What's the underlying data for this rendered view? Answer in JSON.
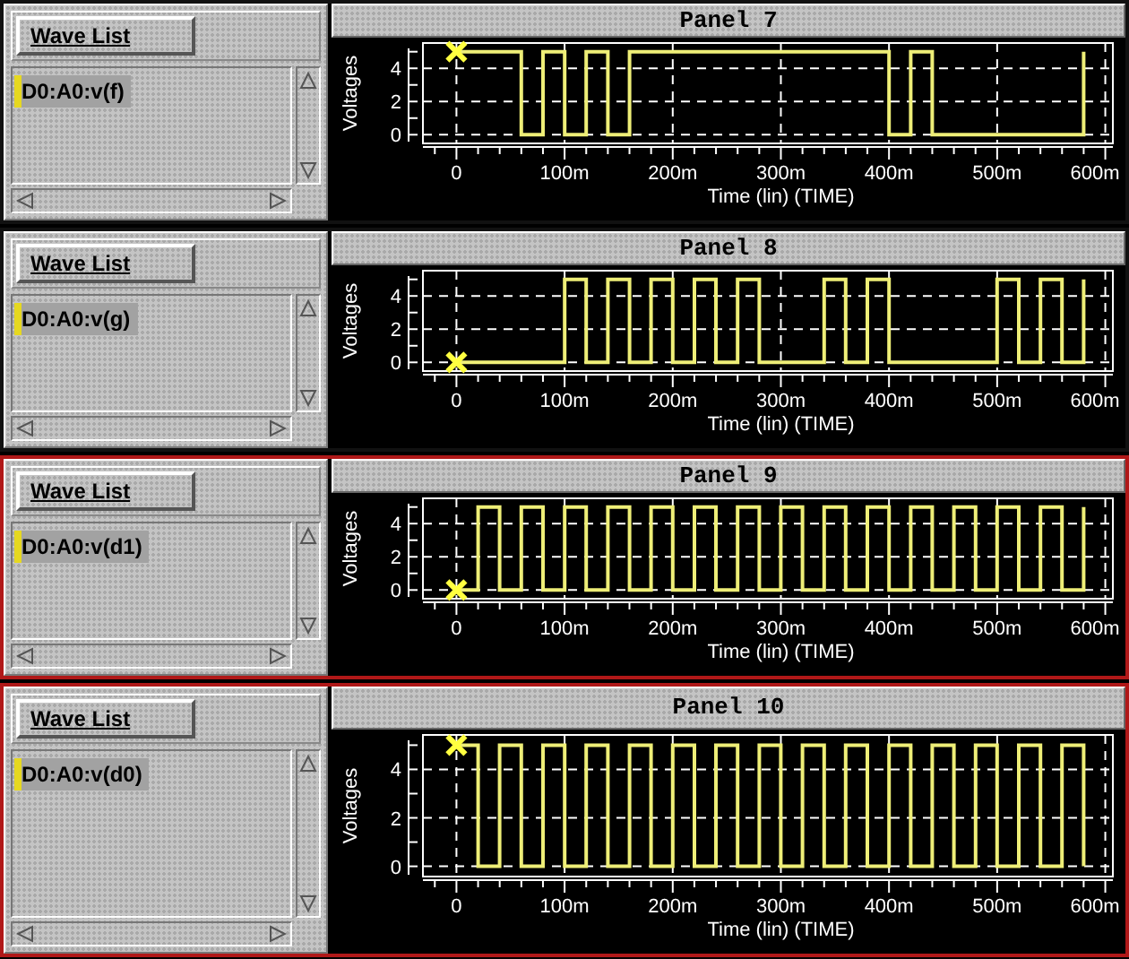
{
  "panels": [
    {
      "highlighted": false,
      "wave_list": {
        "button": "Wave List",
        "items": [
          {
            "label": "D0:A0:v(f)",
            "selected": true
          }
        ]
      },
      "title": "Panel 7",
      "chart_data": {
        "type": "line",
        "xlabel": "Time (lin) (TIME)",
        "ylabel": "Voltages",
        "xlim": [
          -31,
          607
        ],
        "ylim": [
          -0.2,
          5.2
        ],
        "yticks": [
          0,
          2,
          4
        ],
        "grid": true,
        "xticks": [
          {
            "value": 0,
            "label": "0"
          },
          {
            "value": 100,
            "label": "100m"
          },
          {
            "value": 200,
            "label": "200m"
          },
          {
            "value": 300,
            "label": "300m"
          },
          {
            "value": 400,
            "label": "400m"
          },
          {
            "value": 500,
            "label": "500m"
          },
          {
            "value": 600,
            "label": "600m"
          }
        ],
        "x": [
          0,
          60,
          60,
          80,
          80,
          100,
          100,
          120,
          120,
          140,
          140,
          160,
          160,
          400,
          400,
          420,
          420,
          440,
          440,
          580,
          580
        ],
        "series": [
          {
            "color": "#eeee77",
            "values": [
              5,
              5,
              0,
              0,
              5,
              5,
              0,
              0,
              5,
              5,
              0,
              0,
              5,
              5,
              0,
              0,
              5,
              5,
              0,
              0,
              5
            ]
          }
        ]
      }
    },
    {
      "highlighted": false,
      "wave_list": {
        "button": "Wave List",
        "items": [
          {
            "label": "D0:A0:v(g)",
            "selected": true
          }
        ]
      },
      "title": "Panel 8",
      "chart_data": {
        "type": "line",
        "xlabel": "Time (lin) (TIME)",
        "ylabel": "Voltages",
        "xlim": [
          -31,
          607
        ],
        "ylim": [
          -0.2,
          5.2
        ],
        "yticks": [
          0,
          2,
          4
        ],
        "grid": true,
        "xticks": [
          {
            "value": 0,
            "label": "0"
          },
          {
            "value": 100,
            "label": "100m"
          },
          {
            "value": 200,
            "label": "200m"
          },
          {
            "value": 300,
            "label": "300m"
          },
          {
            "value": 400,
            "label": "400m"
          },
          {
            "value": 500,
            "label": "500m"
          },
          {
            "value": 600,
            "label": "600m"
          }
        ],
        "x": [
          0,
          100,
          100,
          120,
          120,
          140,
          140,
          160,
          160,
          180,
          180,
          200,
          200,
          220,
          220,
          240,
          240,
          260,
          260,
          280,
          280,
          340,
          340,
          360,
          360,
          380,
          380,
          400,
          400,
          500,
          500,
          520,
          520,
          540,
          540,
          560,
          560,
          580,
          580
        ],
        "series": [
          {
            "color": "#eeee77",
            "values": [
              0,
              0,
              5,
              5,
              0,
              0,
              5,
              5,
              0,
              0,
              5,
              5,
              0,
              0,
              5,
              5,
              0,
              0,
              5,
              5,
              0,
              0,
              5,
              5,
              0,
              0,
              5,
              5,
              0,
              0,
              5,
              5,
              0,
              0,
              5,
              5,
              0,
              0,
              5
            ]
          }
        ]
      }
    },
    {
      "highlighted": true,
      "wave_list": {
        "button": "Wave List",
        "items": [
          {
            "label": "D0:A0:v(d1)",
            "selected": true
          }
        ]
      },
      "title": "Panel 9",
      "chart_data": {
        "type": "line",
        "xlabel": "Time (lin) (TIME)",
        "ylabel": "Voltages",
        "xlim": [
          -31,
          607
        ],
        "ylim": [
          -0.2,
          5.2
        ],
        "yticks": [
          0,
          2,
          4
        ],
        "grid": true,
        "xticks": [
          {
            "value": 0,
            "label": "0"
          },
          {
            "value": 100,
            "label": "100m"
          },
          {
            "value": 200,
            "label": "200m"
          },
          {
            "value": 300,
            "label": "300m"
          },
          {
            "value": 400,
            "label": "400m"
          },
          {
            "value": 500,
            "label": "500m"
          },
          {
            "value": 600,
            "label": "600m"
          }
        ],
        "x": [
          0,
          20,
          20,
          40,
          40,
          60,
          60,
          80,
          80,
          100,
          100,
          120,
          120,
          140,
          140,
          160,
          160,
          180,
          180,
          200,
          200,
          220,
          220,
          240,
          240,
          260,
          260,
          280,
          280,
          300,
          300,
          320,
          320,
          340,
          340,
          360,
          360,
          380,
          380,
          400,
          400,
          420,
          420,
          440,
          440,
          460,
          460,
          480,
          480,
          500,
          500,
          520,
          520,
          540,
          540,
          560,
          560,
          580,
          580
        ],
        "series": [
          {
            "color": "#eeee77",
            "values": [
              0,
              0,
              5,
              5,
              0,
              0,
              5,
              5,
              0,
              0,
              5,
              5,
              0,
              0,
              5,
              5,
              0,
              0,
              5,
              5,
              0,
              0,
              5,
              5,
              0,
              0,
              5,
              5,
              0,
              0,
              5,
              5,
              0,
              0,
              5,
              5,
              0,
              0,
              5,
              5,
              0,
              0,
              5,
              5,
              0,
              0,
              5,
              5,
              0,
              0,
              5,
              5,
              0,
              0,
              5,
              5,
              0,
              0,
              5
            ]
          }
        ]
      }
    },
    {
      "highlighted": true,
      "wave_list": {
        "button": "Wave List",
        "items": [
          {
            "label": "D0:A0:v(d0)",
            "selected": true
          }
        ]
      },
      "title": "Panel 10",
      "chart_data": {
        "type": "line",
        "xlabel": "Time (lin) (TIME)",
        "ylabel": "Voltages",
        "xlim": [
          -31,
          607
        ],
        "ylim": [
          -0.2,
          5.2
        ],
        "yticks": [
          0,
          2,
          4
        ],
        "grid": true,
        "xticks": [
          {
            "value": 0,
            "label": "0"
          },
          {
            "value": 100,
            "label": "100m"
          },
          {
            "value": 200,
            "label": "200m"
          },
          {
            "value": 300,
            "label": "300m"
          },
          {
            "value": 400,
            "label": "400m"
          },
          {
            "value": 500,
            "label": "500m"
          },
          {
            "value": 600,
            "label": "600m"
          }
        ],
        "x": [
          0,
          20,
          20,
          40,
          40,
          60,
          60,
          80,
          80,
          100,
          100,
          120,
          120,
          140,
          140,
          160,
          160,
          180,
          180,
          200,
          200,
          220,
          220,
          240,
          240,
          260,
          260,
          280,
          280,
          300,
          300,
          320,
          320,
          340,
          340,
          360,
          360,
          380,
          380,
          400,
          400,
          420,
          420,
          440,
          440,
          460,
          460,
          480,
          480,
          500,
          500,
          520,
          520,
          540,
          540,
          560,
          560,
          580,
          580
        ],
        "series": [
          {
            "color": "#eeee77",
            "values": [
              5,
              5,
              0,
              0,
              5,
              5,
              0,
              0,
              5,
              5,
              0,
              0,
              5,
              5,
              0,
              0,
              5,
              5,
              0,
              0,
              5,
              5,
              0,
              0,
              5,
              5,
              0,
              0,
              5,
              5,
              0,
              0,
              5,
              5,
              0,
              0,
              5,
              5,
              0,
              0,
              5,
              5,
              0,
              0,
              5,
              5,
              0,
              0,
              5,
              5,
              0,
              0,
              5,
              5,
              0,
              0,
              5,
              5,
              0
            ]
          }
        ]
      }
    }
  ]
}
